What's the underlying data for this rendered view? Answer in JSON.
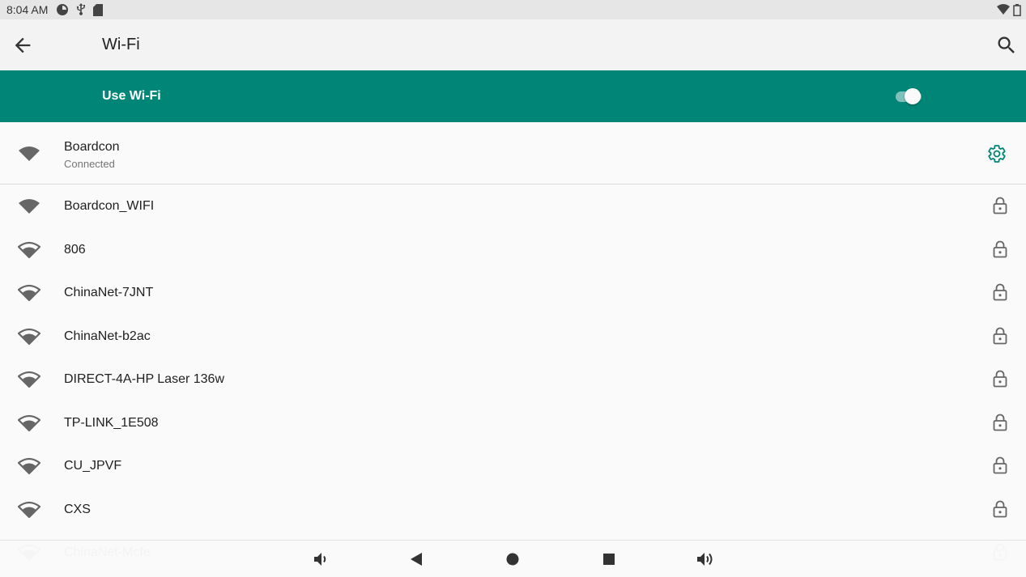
{
  "status_bar": {
    "time": "8:04 AM",
    "left_icons": [
      "pie-chart-icon",
      "usb-icon",
      "sd-card-icon"
    ],
    "right_icons": [
      "wifi-signal-icon",
      "battery-icon"
    ]
  },
  "app_bar": {
    "title": "Wi-Fi",
    "back_icon": "arrow-back-icon",
    "search_icon": "search-icon"
  },
  "master_switch": {
    "label": "Use Wi-Fi",
    "enabled": true,
    "accent_color": "#008577"
  },
  "connected_network": {
    "ssid": "Boardcon",
    "status": "Connected",
    "action_icon": "gear-icon"
  },
  "networks": [
    {
      "ssid": "Boardcon_WIFI",
      "secured": true,
      "signal": "full"
    },
    {
      "ssid": "806",
      "secured": true,
      "signal": "medium"
    },
    {
      "ssid": "ChinaNet-7JNT",
      "secured": true,
      "signal": "medium"
    },
    {
      "ssid": "ChinaNet-b2ac",
      "secured": true,
      "signal": "medium"
    },
    {
      "ssid": "DIRECT-4A-HP Laser 136w",
      "secured": true,
      "signal": "medium"
    },
    {
      "ssid": "TP-LINK_1E508",
      "secured": true,
      "signal": "medium"
    },
    {
      "ssid": "CU_JPVF",
      "secured": true,
      "signal": "medium"
    },
    {
      "ssid": "CXS",
      "secured": true,
      "signal": "medium"
    },
    {
      "ssid": "ChinaNet-Mcfe",
      "secured": true,
      "signal": "medium"
    }
  ],
  "nav_bar": {
    "buttons": [
      "volume-down-icon",
      "back-triangle-icon",
      "home-circle-icon",
      "recents-square-icon",
      "volume-up-icon"
    ]
  }
}
